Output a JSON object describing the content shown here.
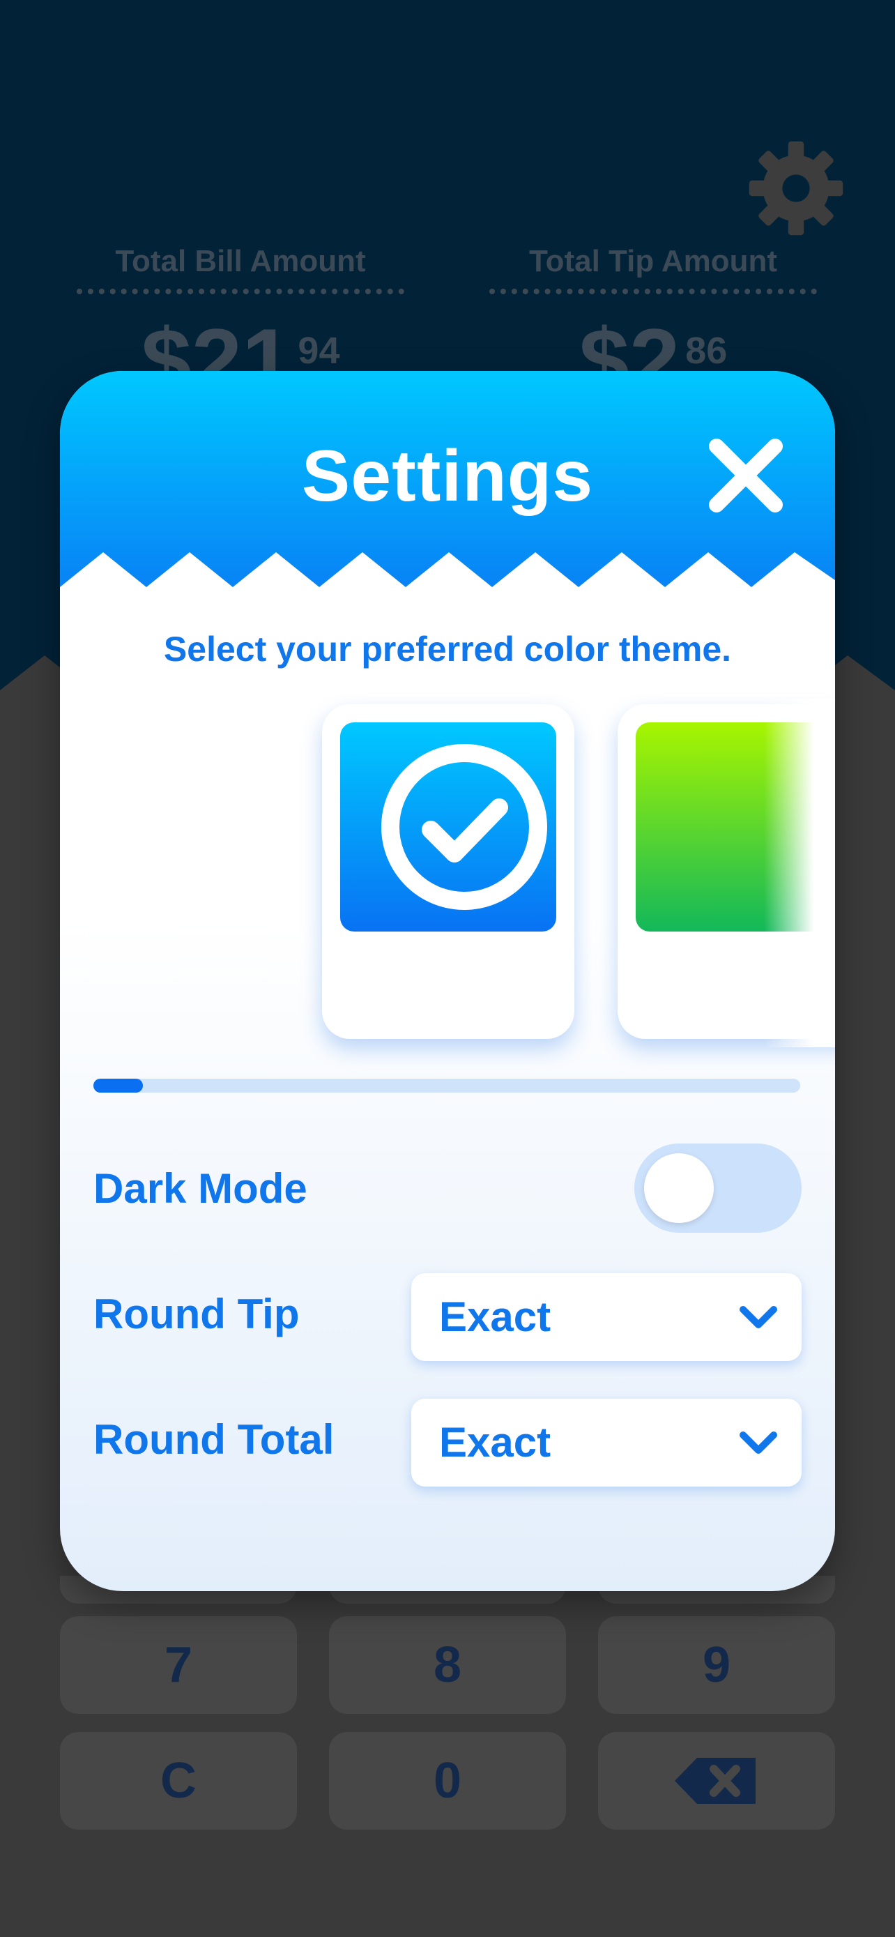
{
  "summary": {
    "bill": {
      "label": "Total Bill Amount",
      "dollars": "$21",
      "cents": "94"
    },
    "tip": {
      "label": "Total Tip Amount",
      "dollars": "$2",
      "cents": "86"
    }
  },
  "keypad": {
    "keys": [
      "7",
      "8",
      "9",
      "C",
      "0"
    ],
    "backspace_icon": "backspace-icon"
  },
  "settings": {
    "title": "Settings",
    "close_icon": "close-icon",
    "theme_prompt": "Select your preferred color theme.",
    "themes": [
      {
        "name": "blue",
        "selected": true,
        "colors": [
          "#00c8ff",
          "#0872f3"
        ]
      },
      {
        "name": "green",
        "selected": false,
        "colors": [
          "#a8f500",
          "#12b85a"
        ]
      }
    ],
    "theme_scroll_progress": 0.07,
    "dark_mode": {
      "label": "Dark Mode",
      "enabled": false
    },
    "round_tip": {
      "label": "Round Tip",
      "value": "Exact"
    },
    "round_total": {
      "label": "Round Total",
      "value": "Exact"
    }
  },
  "colors": {
    "accent": "#1076ec",
    "header_top": "#00c8ff",
    "header_bottom": "#0880f5",
    "app_background": "#022238",
    "keypad_background": "#3a3a3a"
  }
}
